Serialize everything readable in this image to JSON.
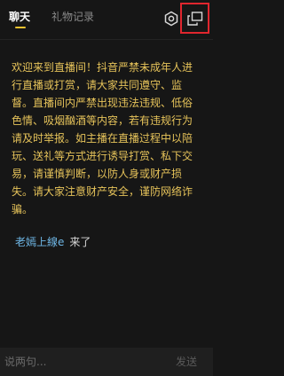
{
  "header": {
    "tabs": [
      {
        "label": "聊天",
        "active": true
      },
      {
        "label": "礼物记录",
        "active": false
      }
    ],
    "accent_color": "#f2c230",
    "icons": [
      "settings-icon",
      "popout-window-icon"
    ],
    "highlight_color": "#e0262e"
  },
  "notice": {
    "text": "欢迎来到直播间！抖音严禁未成年人进行直播或打赏，请大家共同遵守、监督。直播间内严禁出现违法违规、低俗色情、吸烟酗酒等内容，若有违规行为请及时举报。如主播在直播过程中以陪玩、送礼等方式进行诱导打赏、私下交易，请谨慎判断，以防人身或财产损失。请大家注意财产安全，谨防网络诈骗。",
    "color": "#e6c35a"
  },
  "messages": [
    {
      "user": "老嫣上線e",
      "text": "来了",
      "user_color": "#6fb7e6"
    }
  ],
  "input": {
    "placeholder": "说两句...",
    "value": "",
    "send_label": "发送"
  }
}
